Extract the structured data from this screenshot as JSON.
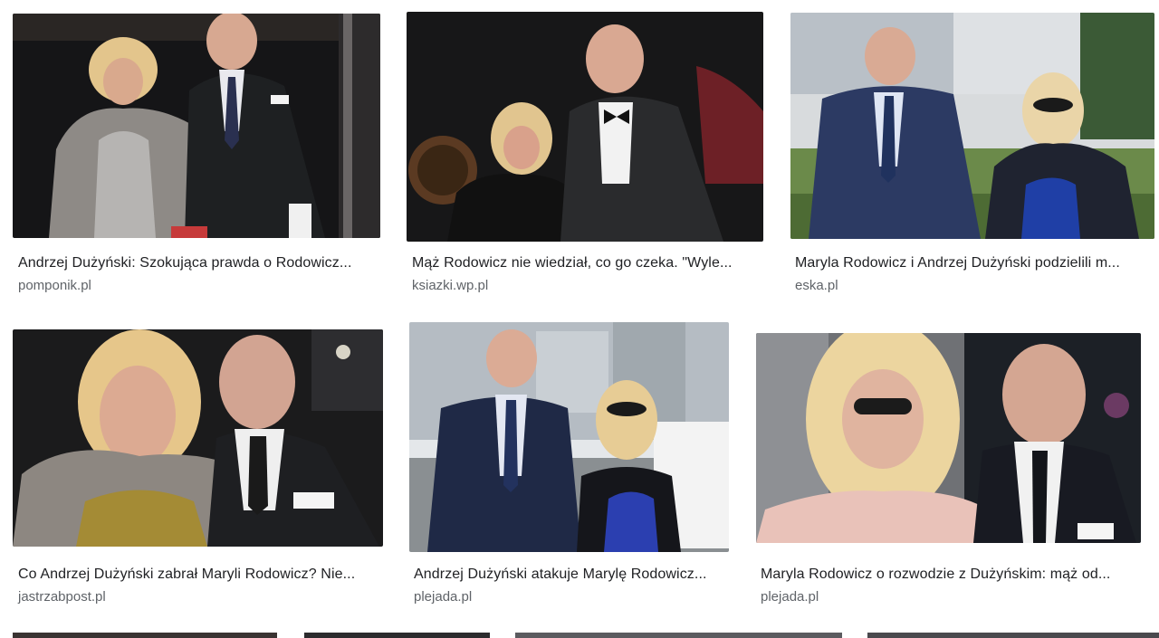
{
  "colors": {
    "title_text": "#202124",
    "source_text": "#5f6368",
    "background": "#ffffff"
  },
  "results": [
    {
      "title": "Andrzej Dużyński: Szokująca prawda o Rodowicz...",
      "source": "pomponik.pl"
    },
    {
      "title": "Mąż Rodowicz nie wiedział, co go czeka. \"Wyle...",
      "source": "ksiazki.wp.pl"
    },
    {
      "title": "Maryla Rodowicz i Andrzej Dużyński podzielili m...",
      "source": "eska.pl"
    },
    {
      "title": "Co Andrzej Dużyński zabrał Maryli Rodowicz? Nie...",
      "source": "jastrzabpost.pl"
    },
    {
      "title": "Andrzej Dużyński atakuje Marylę Rodowicz...",
      "source": "plejada.pl"
    },
    {
      "title": "Maryla Rodowicz o rozwodzie z Dużyńskim: mąż od...",
      "source": "plejada.pl"
    }
  ]
}
